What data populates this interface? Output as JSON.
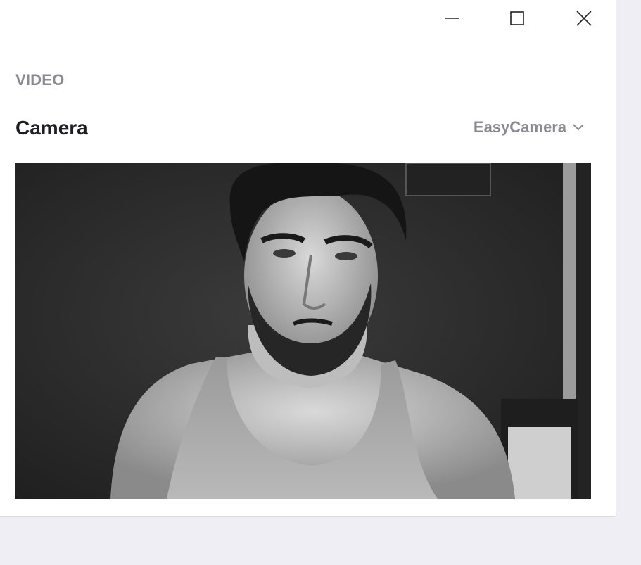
{
  "section": {
    "title": "VIDEO"
  },
  "camera": {
    "label": "Camera",
    "selected_device": "EasyCamera"
  },
  "window_controls": [
    "minimize-icon",
    "maximize-icon",
    "close-icon"
  ],
  "colors": {
    "panel_bg": "#ffffff",
    "page_bg": "#efeef5",
    "label_gray": "#8b8a93",
    "text_dark": "#1e1e22"
  }
}
